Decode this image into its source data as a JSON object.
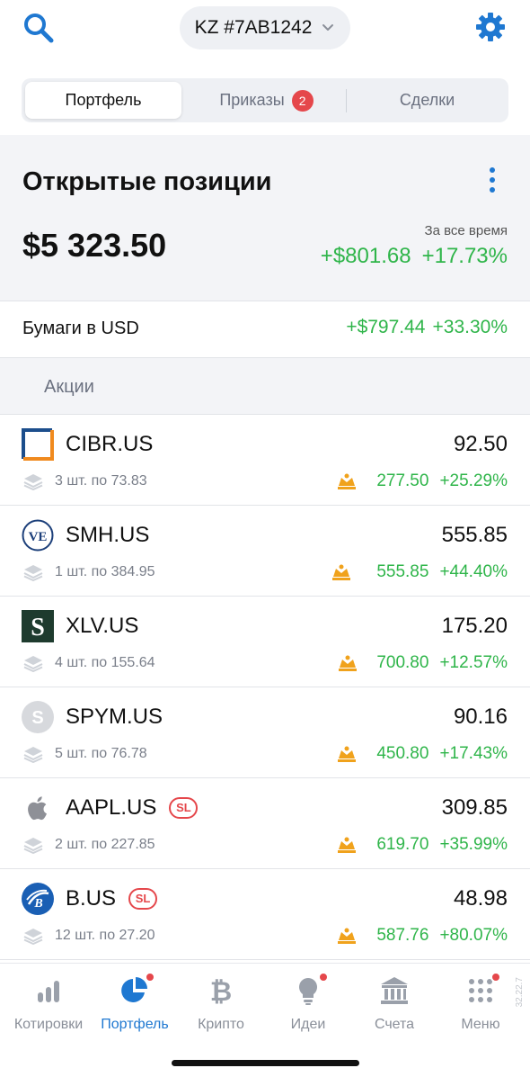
{
  "header": {
    "account": "KZ #7AB1242",
    "icons": {
      "search": "search-icon",
      "account_dropdown": "chevron-down-icon",
      "settings": "gear-icon"
    }
  },
  "tabs": {
    "portfolio": "Портфель",
    "orders": "Приказы",
    "orders_badge": "2",
    "deals": "Сделки",
    "active": "portfolio"
  },
  "summary": {
    "title": "Открытые позиции",
    "total": "$5 323.50",
    "period_label": "За все время",
    "change_abs": "+$801.68",
    "change_pct": "+17.73%"
  },
  "currency_group": {
    "label": "Бумаги в USD",
    "change_abs": "+$797.44",
    "change_pct": "+33.30%"
  },
  "section": {
    "label": "Акции"
  },
  "positions": [
    {
      "ticker": "CIBR.US",
      "price": "92.50",
      "qty": "3 шт. по 73.83",
      "pl_abs": "277.50",
      "pl_pct": "+25.29%",
      "sl": "",
      "logo": "cibr-logo"
    },
    {
      "ticker": "SMH.US",
      "price": "555.85",
      "qty": "1 шт. по 384.95",
      "pl_abs": "555.85",
      "pl_pct": "+44.40%",
      "sl": "",
      "logo": "vaneck-logo"
    },
    {
      "ticker": "XLV.US",
      "price": "175.20",
      "qty": "4 шт. по 155.64",
      "pl_abs": "700.80",
      "pl_pct": "+12.57%",
      "sl": "",
      "logo": "spdr-logo"
    },
    {
      "ticker": "SPYM.US",
      "price": "90.16",
      "qty": "5 шт. по 76.78",
      "pl_abs": "450.80",
      "pl_pct": "+17.43%",
      "sl": "",
      "logo": "generic-s-logo"
    },
    {
      "ticker": "AAPL.US",
      "price": "309.85",
      "qty": "2 шт. по 227.85",
      "pl_abs": "619.70",
      "pl_pct": "+35.99%",
      "sl": "SL",
      "logo": "apple-logo"
    },
    {
      "ticker": "B.US",
      "price": "48.98",
      "qty": "12 шт. по 27.20",
      "pl_abs": "587.76",
      "pl_pct": "+80.07%",
      "sl": "SL",
      "logo": "barrick-logo"
    }
  ],
  "tabbar": {
    "items": [
      {
        "label": "Котировки",
        "icon": "bar-chart-icon",
        "dot": false
      },
      {
        "label": "Портфель",
        "icon": "pie-chart-icon",
        "dot": true
      },
      {
        "label": "Крипто",
        "icon": "bitcoin-icon",
        "dot": false
      },
      {
        "label": "Идеи",
        "icon": "lightbulb-icon",
        "dot": true
      },
      {
        "label": "Счета",
        "icon": "bank-icon",
        "dot": false
      },
      {
        "label": "Меню",
        "icon": "grid-dots-icon",
        "dot": true
      }
    ],
    "active_index": 1
  },
  "version": "32.22.7",
  "colors": {
    "accent": "#1f78d1",
    "positive": "#2fb54a",
    "negative": "#e5474b",
    "crown": "#f0a21c",
    "background_alt": "#f3f4f7"
  }
}
